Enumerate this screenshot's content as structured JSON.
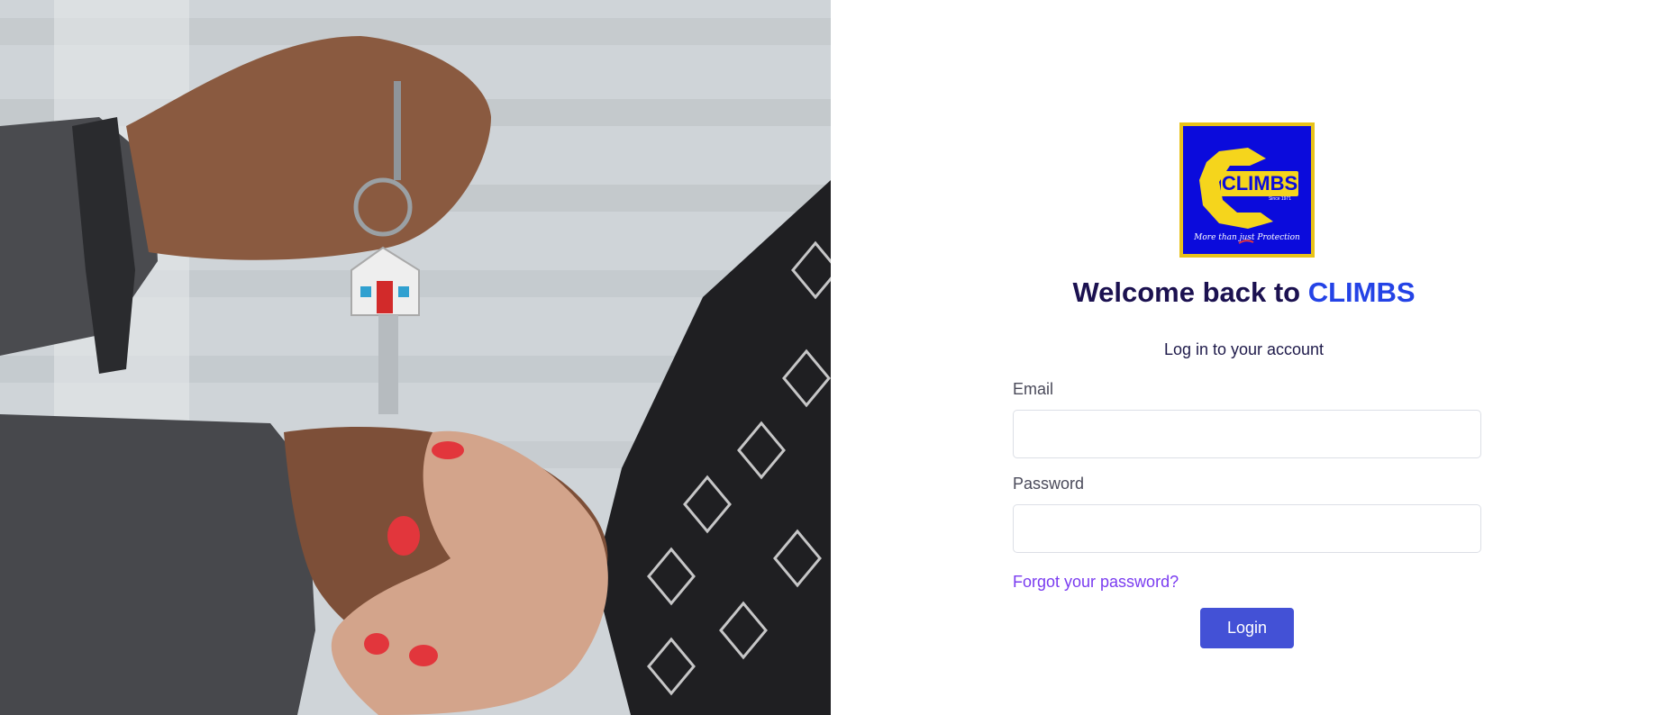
{
  "hero": {
    "image": "hands-exchanging-house-key-photo"
  },
  "logo": {
    "text": "CLIMBS",
    "tagline": "More than just Protection",
    "since": "Since 1971"
  },
  "header": {
    "title_prefix": "Welcome back to ",
    "title_brand": "CLIMBS",
    "subtitle": "Log in to your account"
  },
  "form": {
    "email_label": "Email",
    "email_value": "",
    "password_label": "Password",
    "password_value": "",
    "forgot_link": "Forgot your password?",
    "login_button": "Login"
  },
  "colors": {
    "brand_text": "#2443e6",
    "title_text": "#1b1150",
    "button": "#4351d6",
    "link": "#7a3cf0",
    "logo_bg": "#0b0bdc",
    "logo_gold": "#e8c21a"
  }
}
